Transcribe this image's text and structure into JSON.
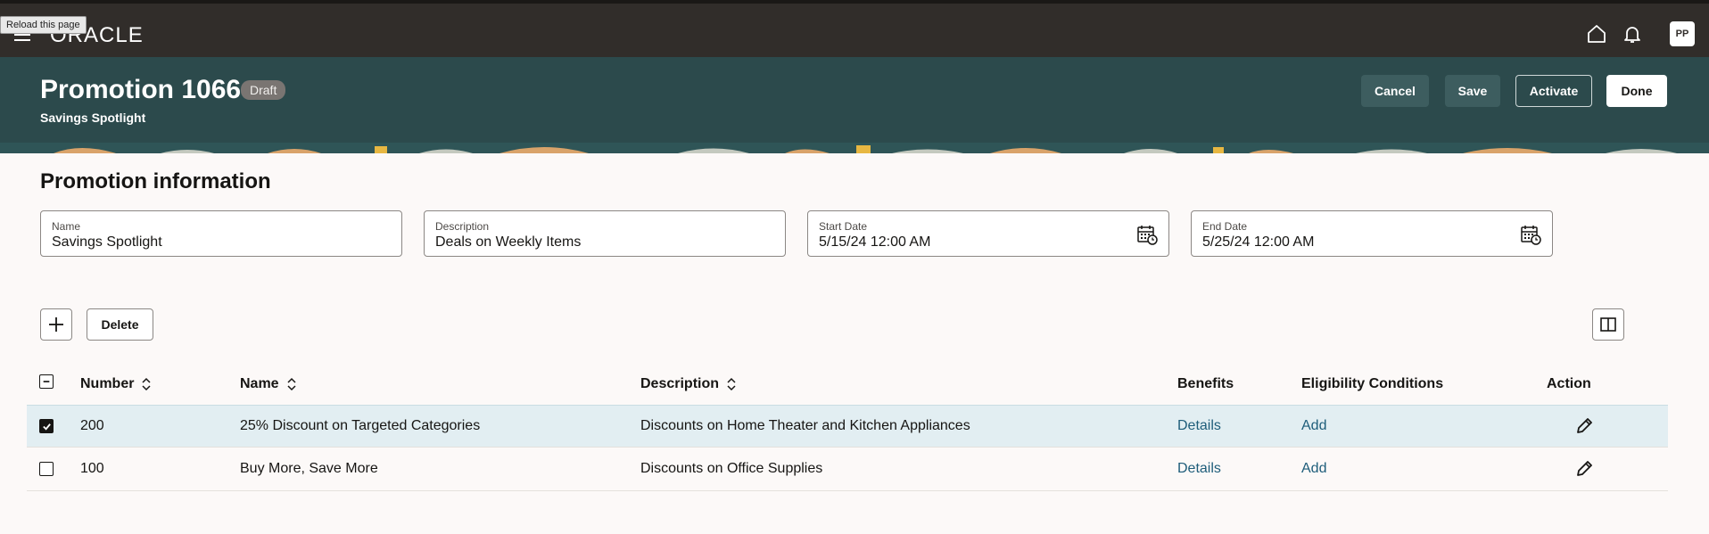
{
  "topbar": {
    "tooltip": "Reload this page",
    "logo_text": "ORACLE",
    "avatar_initials": "PP",
    "icons": [
      "menu-icon",
      "home-icon",
      "bell-icon"
    ]
  },
  "header": {
    "title": "Promotion 1066",
    "status_badge": "Draft",
    "subtitle": "Savings Spotlight",
    "buttons": {
      "cancel": "Cancel",
      "save": "Save",
      "activate": "Activate",
      "done": "Done"
    }
  },
  "promotion_info": {
    "section_title": "Promotion information",
    "fields": {
      "name": {
        "label": "Name",
        "value": "Savings Spotlight"
      },
      "description": {
        "label": "Description",
        "value": "Deals on Weekly Items"
      },
      "start_date": {
        "label": "Start Date",
        "value": "5/15/24 12:00 AM"
      },
      "end_date": {
        "label": "End Date",
        "value": "5/25/24 12:00 AM"
      }
    }
  },
  "toolbar": {
    "delete_label": "Delete",
    "icons": [
      "add-icon",
      "columns-icon"
    ]
  },
  "table": {
    "columns": {
      "number": "Number",
      "name": "Name",
      "description": "Description",
      "benefits": "Benefits",
      "eligibility": "Eligibility Conditions",
      "action": "Action"
    },
    "rows": [
      {
        "selected": true,
        "number": "200",
        "name": "25% Discount on Targeted Categories",
        "description": "Discounts on Home Theater and Kitchen Appliances",
        "benefits": "Details",
        "eligibility": "Add"
      },
      {
        "selected": false,
        "number": "100",
        "name": "Buy More, Save More",
        "description": "Discounts on Office Supplies",
        "benefits": "Details",
        "eligibility": "Add"
      }
    ]
  },
  "colors": {
    "topbar_bg": "#312d2a",
    "header_bg": "#2c4a4c",
    "link": "#1e5d7a",
    "selected_row": "#e2eef2",
    "page_bg": "#fcf9f8"
  }
}
